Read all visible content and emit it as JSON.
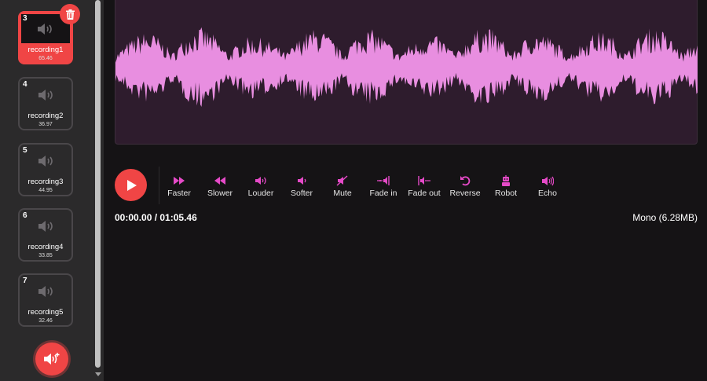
{
  "recordings": [
    {
      "num": "3",
      "name": "recording1",
      "duration": "65.46",
      "selected": true
    },
    {
      "num": "4",
      "name": "recording2",
      "duration": "36.97",
      "selected": false
    },
    {
      "num": "5",
      "name": "recording3",
      "duration": "44.95",
      "selected": false
    },
    {
      "num": "6",
      "name": "recording4",
      "duration": "33.85",
      "selected": false
    },
    {
      "num": "7",
      "name": "recording5",
      "duration": "32.46",
      "selected": false
    }
  ],
  "effects": [
    {
      "label": "Faster",
      "icon": "fast-forward-icon"
    },
    {
      "label": "Slower",
      "icon": "rewind-icon"
    },
    {
      "label": "Louder",
      "icon": "volume-up-icon"
    },
    {
      "label": "Softer",
      "icon": "volume-down-icon"
    },
    {
      "label": "Mute",
      "icon": "mute-icon"
    },
    {
      "label": "Fade in",
      "icon": "fade-in-icon"
    },
    {
      "label": "Fade out",
      "icon": "fade-out-icon"
    },
    {
      "label": "Reverse",
      "icon": "reverse-icon"
    },
    {
      "label": "Robot",
      "icon": "robot-icon"
    },
    {
      "label": "Echo",
      "icon": "echo-icon"
    }
  ],
  "player": {
    "time": "00:00.00 / 01:05.46",
    "info": "Mono (6.28MB)"
  },
  "colors": {
    "accent": "#f04545",
    "effect_icon": "#e64ac8",
    "waveform": "#e88ee0",
    "waveform_bg": "#2e1c2d"
  }
}
